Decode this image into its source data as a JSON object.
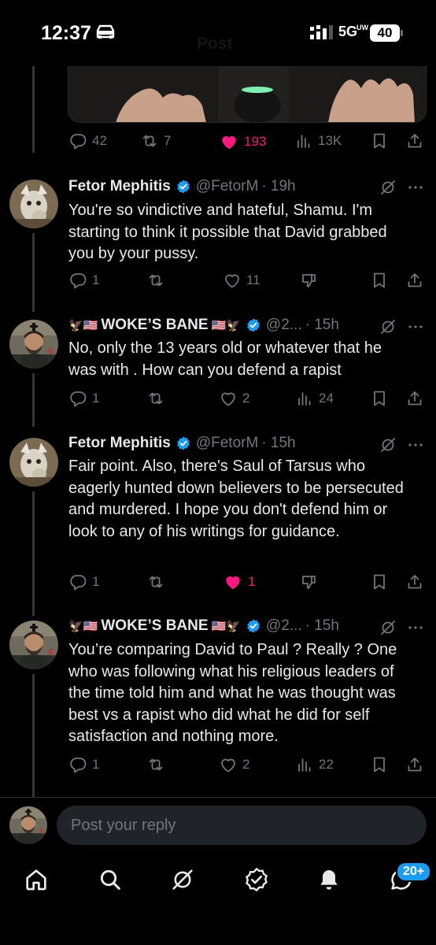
{
  "status_bar": {
    "time": "12:37",
    "network": "5G",
    "network_sub": "UW",
    "battery": "40"
  },
  "header": {
    "title": "Post"
  },
  "parent_tweet_actions": {
    "replies": "42",
    "reposts": "7",
    "likes": "193",
    "views": "13K"
  },
  "tweets": [
    {
      "name": "Fetor Mephitis",
      "handle": "@FetorM",
      "time": "· 19h",
      "text": "You're so vindictive and hateful, Shamu. I'm starting to think it possible that David grabbed you by your pussy.",
      "replies": "1",
      "reposts": "",
      "likes": "11",
      "views": ""
    },
    {
      "name_prefix": "🦅🇺🇸",
      "name": "WOKE’S BANE",
      "name_suffix": "🇺🇸🦅",
      "handle": "@2...",
      "time": "· 15h",
      "text": "No, only the 13 years old or whatever that he was with . How can you defend a rapist",
      "replies": "1",
      "reposts": "",
      "likes": "2",
      "views": "24"
    },
    {
      "name": "Fetor Mephitis",
      "handle": "@FetorM",
      "time": "· 15h",
      "text": "Fair point. Also, there's Saul of Tarsus who eagerly hunted down believers to be persecuted and murdered. I hope you don't defend him or look to any of his writings for guidance.",
      "replies": "1",
      "reposts": "",
      "likes": "1",
      "views": ""
    },
    {
      "name_prefix": "🦅🇺🇸",
      "name": "WOKE’S BANE",
      "name_suffix": "🇺🇸🦅",
      "handle": "@2...",
      "time": "· 15h",
      "text": "You’re comparing David to Paul ? Really ? One who was following what his religious leaders of the time told him and what he was thought was best vs a rapist who did what he did for self satisfaction and nothing more.",
      "replies": "1",
      "reposts": "",
      "likes": "2",
      "views": "22"
    }
  ],
  "reply": {
    "placeholder": "Post your reply"
  },
  "bottom_nav": {
    "badge": "20+",
    "items": [
      "home-icon",
      "search-icon",
      "grok-icon",
      "communities-icon",
      "notifications-icon",
      "messages-icon"
    ]
  },
  "colors": {
    "background": "#000000",
    "text": "#e7e9ea",
    "muted": "#71767b",
    "like": "#f91880",
    "verified": "#1d9bf0",
    "input": "#202327"
  }
}
